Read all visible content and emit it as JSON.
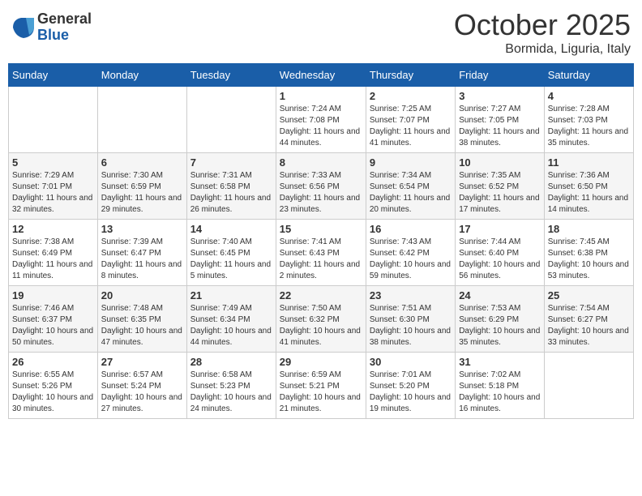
{
  "header": {
    "logo_general": "General",
    "logo_blue": "Blue",
    "month": "October 2025",
    "location": "Bormida, Liguria, Italy"
  },
  "weekdays": [
    "Sunday",
    "Monday",
    "Tuesday",
    "Wednesday",
    "Thursday",
    "Friday",
    "Saturday"
  ],
  "weeks": [
    [
      {
        "day": "",
        "info": ""
      },
      {
        "day": "",
        "info": ""
      },
      {
        "day": "",
        "info": ""
      },
      {
        "day": "1",
        "info": "Sunrise: 7:24 AM\nSunset: 7:08 PM\nDaylight: 11 hours and 44 minutes."
      },
      {
        "day": "2",
        "info": "Sunrise: 7:25 AM\nSunset: 7:07 PM\nDaylight: 11 hours and 41 minutes."
      },
      {
        "day": "3",
        "info": "Sunrise: 7:27 AM\nSunset: 7:05 PM\nDaylight: 11 hours and 38 minutes."
      },
      {
        "day": "4",
        "info": "Sunrise: 7:28 AM\nSunset: 7:03 PM\nDaylight: 11 hours and 35 minutes."
      }
    ],
    [
      {
        "day": "5",
        "info": "Sunrise: 7:29 AM\nSunset: 7:01 PM\nDaylight: 11 hours and 32 minutes."
      },
      {
        "day": "6",
        "info": "Sunrise: 7:30 AM\nSunset: 6:59 PM\nDaylight: 11 hours and 29 minutes."
      },
      {
        "day": "7",
        "info": "Sunrise: 7:31 AM\nSunset: 6:58 PM\nDaylight: 11 hours and 26 minutes."
      },
      {
        "day": "8",
        "info": "Sunrise: 7:33 AM\nSunset: 6:56 PM\nDaylight: 11 hours and 23 minutes."
      },
      {
        "day": "9",
        "info": "Sunrise: 7:34 AM\nSunset: 6:54 PM\nDaylight: 11 hours and 20 minutes."
      },
      {
        "day": "10",
        "info": "Sunrise: 7:35 AM\nSunset: 6:52 PM\nDaylight: 11 hours and 17 minutes."
      },
      {
        "day": "11",
        "info": "Sunrise: 7:36 AM\nSunset: 6:50 PM\nDaylight: 11 hours and 14 minutes."
      }
    ],
    [
      {
        "day": "12",
        "info": "Sunrise: 7:38 AM\nSunset: 6:49 PM\nDaylight: 11 hours and 11 minutes."
      },
      {
        "day": "13",
        "info": "Sunrise: 7:39 AM\nSunset: 6:47 PM\nDaylight: 11 hours and 8 minutes."
      },
      {
        "day": "14",
        "info": "Sunrise: 7:40 AM\nSunset: 6:45 PM\nDaylight: 11 hours and 5 minutes."
      },
      {
        "day": "15",
        "info": "Sunrise: 7:41 AM\nSunset: 6:43 PM\nDaylight: 11 hours and 2 minutes."
      },
      {
        "day": "16",
        "info": "Sunrise: 7:43 AM\nSunset: 6:42 PM\nDaylight: 10 hours and 59 minutes."
      },
      {
        "day": "17",
        "info": "Sunrise: 7:44 AM\nSunset: 6:40 PM\nDaylight: 10 hours and 56 minutes."
      },
      {
        "day": "18",
        "info": "Sunrise: 7:45 AM\nSunset: 6:38 PM\nDaylight: 10 hours and 53 minutes."
      }
    ],
    [
      {
        "day": "19",
        "info": "Sunrise: 7:46 AM\nSunset: 6:37 PM\nDaylight: 10 hours and 50 minutes."
      },
      {
        "day": "20",
        "info": "Sunrise: 7:48 AM\nSunset: 6:35 PM\nDaylight: 10 hours and 47 minutes."
      },
      {
        "day": "21",
        "info": "Sunrise: 7:49 AM\nSunset: 6:34 PM\nDaylight: 10 hours and 44 minutes."
      },
      {
        "day": "22",
        "info": "Sunrise: 7:50 AM\nSunset: 6:32 PM\nDaylight: 10 hours and 41 minutes."
      },
      {
        "day": "23",
        "info": "Sunrise: 7:51 AM\nSunset: 6:30 PM\nDaylight: 10 hours and 38 minutes."
      },
      {
        "day": "24",
        "info": "Sunrise: 7:53 AM\nSunset: 6:29 PM\nDaylight: 10 hours and 35 minutes."
      },
      {
        "day": "25",
        "info": "Sunrise: 7:54 AM\nSunset: 6:27 PM\nDaylight: 10 hours and 33 minutes."
      }
    ],
    [
      {
        "day": "26",
        "info": "Sunrise: 6:55 AM\nSunset: 5:26 PM\nDaylight: 10 hours and 30 minutes."
      },
      {
        "day": "27",
        "info": "Sunrise: 6:57 AM\nSunset: 5:24 PM\nDaylight: 10 hours and 27 minutes."
      },
      {
        "day": "28",
        "info": "Sunrise: 6:58 AM\nSunset: 5:23 PM\nDaylight: 10 hours and 24 minutes."
      },
      {
        "day": "29",
        "info": "Sunrise: 6:59 AM\nSunset: 5:21 PM\nDaylight: 10 hours and 21 minutes."
      },
      {
        "day": "30",
        "info": "Sunrise: 7:01 AM\nSunset: 5:20 PM\nDaylight: 10 hours and 19 minutes."
      },
      {
        "day": "31",
        "info": "Sunrise: 7:02 AM\nSunset: 5:18 PM\nDaylight: 10 hours and 16 minutes."
      },
      {
        "day": "",
        "info": ""
      }
    ]
  ]
}
